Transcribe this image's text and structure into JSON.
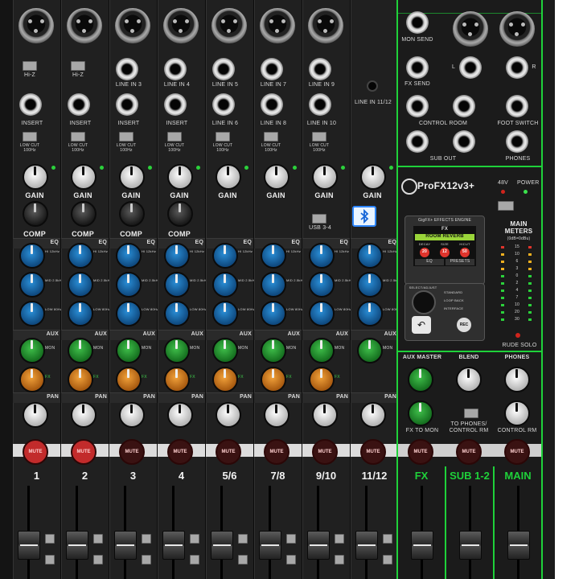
{
  "channels": [
    {
      "number": "1",
      "top_label": "Hi-Z",
      "insert": "INSERT",
      "lowcut": "LOW CUT 100Hz",
      "gain": "GAIN",
      "comp": "COMP",
      "mute": "MUTE",
      "mute_active": true
    },
    {
      "number": "2",
      "top_label": "Hi-Z",
      "insert": "INSERT",
      "lowcut": "LOW CUT 100Hz",
      "gain": "GAIN",
      "comp": "COMP",
      "mute": "MUTE",
      "mute_active": true
    },
    {
      "number": "3",
      "top_label": "LINE IN 3",
      "insert": "INSERT",
      "lowcut": "LOW CUT 100Hz",
      "gain": "GAIN",
      "comp": "COMP",
      "mute": "MUTE",
      "mute_active": false
    },
    {
      "number": "4",
      "top_label": "LINE IN 4",
      "insert": "INSERT",
      "lowcut": "LOW CUT 100Hz",
      "gain": "GAIN",
      "comp": "COMP",
      "mute": "MUTE",
      "mute_active": false
    },
    {
      "number": "5/6",
      "top_label": "LINE IN 5",
      "second_label": "LINE IN 6",
      "lowcut": "LOW CUT 100Hz",
      "gain": "GAIN",
      "mute": "MUTE",
      "mute_active": false
    },
    {
      "number": "7/8",
      "top_label": "LINE IN 7",
      "second_label": "LINE IN 8",
      "lowcut": "LOW CUT 100Hz",
      "gain": "GAIN",
      "mute": "MUTE",
      "mute_active": false
    },
    {
      "number": "9/10",
      "top_label": "LINE IN 9",
      "second_label": "LINE IN 10",
      "lowcut": "LOW CUT 100Hz",
      "gain": "GAIN",
      "mute": "MUTE",
      "mute_active": false
    },
    {
      "number": "11/12",
      "top_label": "LINE IN 11/12",
      "gain": "GAIN",
      "usb": "USB 3-4",
      "mute": "MUTE",
      "mute_active": false
    }
  ],
  "section_labels": {
    "eq": "EQ",
    "aux": "AUX",
    "pan": "PAN",
    "comp": "COMP"
  },
  "eq_labels": {
    "hi": "HI 12kHz",
    "mid": "MID 2.5kHz",
    "low": "LOW 80Hz"
  },
  "aux_labels": {
    "mon": "MON",
    "fx": "FX"
  },
  "right_panel": {
    "mon_send": "MON SEND",
    "fx_send": "FX SEND",
    "control_room": "CONTROL ROOM",
    "sub_out": "SUB OUT",
    "foot_switch": "FOOT SWITCH",
    "phones": "PHONES",
    "main_left": "L",
    "main_right": "R",
    "brand": "ProFX12v3+",
    "phantom": "48V",
    "power": "POWER",
    "main_meters": "MAIN METERS",
    "meters_sub": "(0dB=0dBu)",
    "rude_solo": "RUDE SOLO",
    "aux_master": "AUX MASTER",
    "blend": "BLEND",
    "fx_to_mon": "FX TO MON",
    "to_phones": "TO PHONES/ CONTROL RM",
    "phones_knob": "PHONES",
    "control_rm": "CONTROL RM",
    "fx_label": "FX",
    "sub_label": "SUB 1-2",
    "main_label": "MAIN",
    "mute": "MUTE"
  },
  "fx_engine": {
    "title": "GigFX+ EFFECTS ENGINE",
    "mode": "FX",
    "preset": "ROOM REVERB",
    "params": [
      "DECAY",
      "SIZE",
      "HICUT"
    ],
    "param_values": [
      "20",
      "12",
      "50"
    ],
    "buttons": [
      "EQ",
      "PRESETS"
    ],
    "options": [
      "STANDARD",
      "LOOP BACK",
      "INTERFACE"
    ],
    "rec": "REC",
    "select_adjust": "SELECT/ADJUST"
  },
  "bluetooth_icon": "bluetooth-icon",
  "meter_scale": [
    "15",
    "10",
    "6",
    "3",
    "0",
    "2",
    "4",
    "7",
    "10",
    "20",
    "30"
  ],
  "colors": {
    "accent_green": "#1fd13a",
    "mute_red": "#6a1515",
    "eq_blue": "#1c7cd0",
    "mon_green": "#2fb43c",
    "fx_orange": "#f0981e",
    "lcd_green": "#9ad53a",
    "value_red": "#e0342c"
  }
}
